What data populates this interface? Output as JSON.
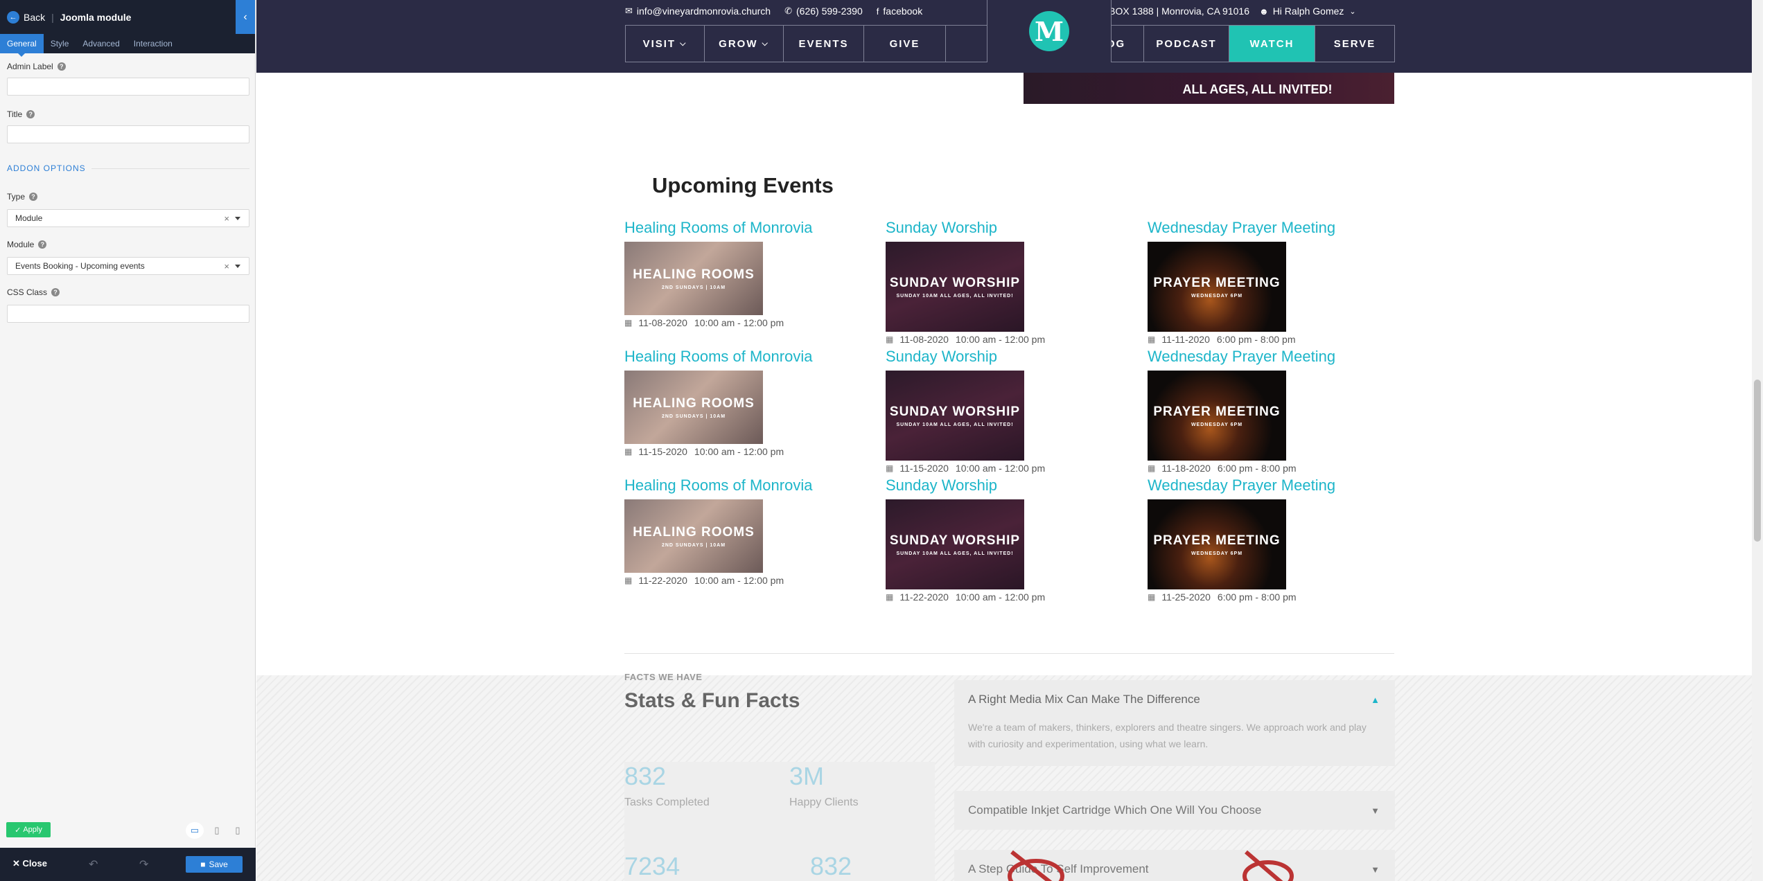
{
  "panel": {
    "back_label": "Back",
    "title": "Joomla module",
    "tabs": [
      "General",
      "Style",
      "Advanced",
      "Interaction"
    ],
    "admin_label": "Admin Label",
    "title_label": "Title",
    "addon_options": "ADDON OPTIONS",
    "type_label": "Type",
    "type_value": "Module",
    "module_label": "Module",
    "module_value": "Events Booking - Upcoming events",
    "css_class_label": "CSS Class",
    "apply_label": "Apply",
    "close_label": "Close",
    "save_label": "Save"
  },
  "topbar": {
    "email": "info@vineyardmonrovia.church",
    "phone": "(626) 599-2390",
    "facebook": "facebook",
    "address": "PO BOX 1388 | Monrovia, CA 91016",
    "user": "Hi Ralph Gomez"
  },
  "nav": {
    "visit": "VISIT",
    "grow": "GROW",
    "events": "EVENTS",
    "give": "GIVE",
    "logo_letter": "M",
    "blog": "BLOG",
    "podcast": "PODCAST",
    "watch": "WATCH",
    "serve": "SERVE"
  },
  "hero_peek_text": "ALL AGES, ALL INVITED!",
  "events": {
    "heading": "Upcoming Events",
    "columns": [
      {
        "title": "Healing Rooms of Monrovia",
        "img_big": "HEALING ROOMS",
        "img_small": "2ND SUNDAYS | 10AM",
        "dates": [
          "11-08-2020",
          "11-15-2020",
          "11-22-2020"
        ],
        "time": "10:00 am - 12:00 pm"
      },
      {
        "title": "Sunday Worship",
        "img_big": "SUNDAY WORSHIP",
        "img_small": "SUNDAY 10AM ALL AGES, ALL INVITED!",
        "dates": [
          "11-08-2020",
          "11-15-2020",
          "11-22-2020"
        ],
        "time": "10:00 am - 12:00 pm"
      },
      {
        "title": "Wednesday Prayer Meeting",
        "img_big": "PRAYER MEETING",
        "img_small": "WEDNESDAY 6PM",
        "dates": [
          "11-11-2020",
          "11-18-2020",
          "11-25-2020"
        ],
        "time": "6:00 pm - 8:00 pm"
      }
    ]
  },
  "facts": {
    "kicker": "FACTS WE HAVE",
    "title": "Stats & Fun Facts",
    "stats": [
      {
        "num": "832",
        "label": "Tasks Completed"
      },
      {
        "num": "3M",
        "label": "Happy Clients"
      },
      {
        "num": "7234",
        "label": ""
      },
      {
        "num": "832",
        "label": ""
      }
    ],
    "accordion": [
      {
        "title": "A Right Media Mix Can Make The Difference",
        "body": "We're a team of makers, thinkers, explorers and theatre singers. We approach work and play with curiosity and experimentation, using what we learn."
      },
      {
        "title": "Compatible Inkjet Cartridge Which One Will You Choose"
      },
      {
        "title": "A Step Guide To Self Improvement"
      }
    ]
  }
}
